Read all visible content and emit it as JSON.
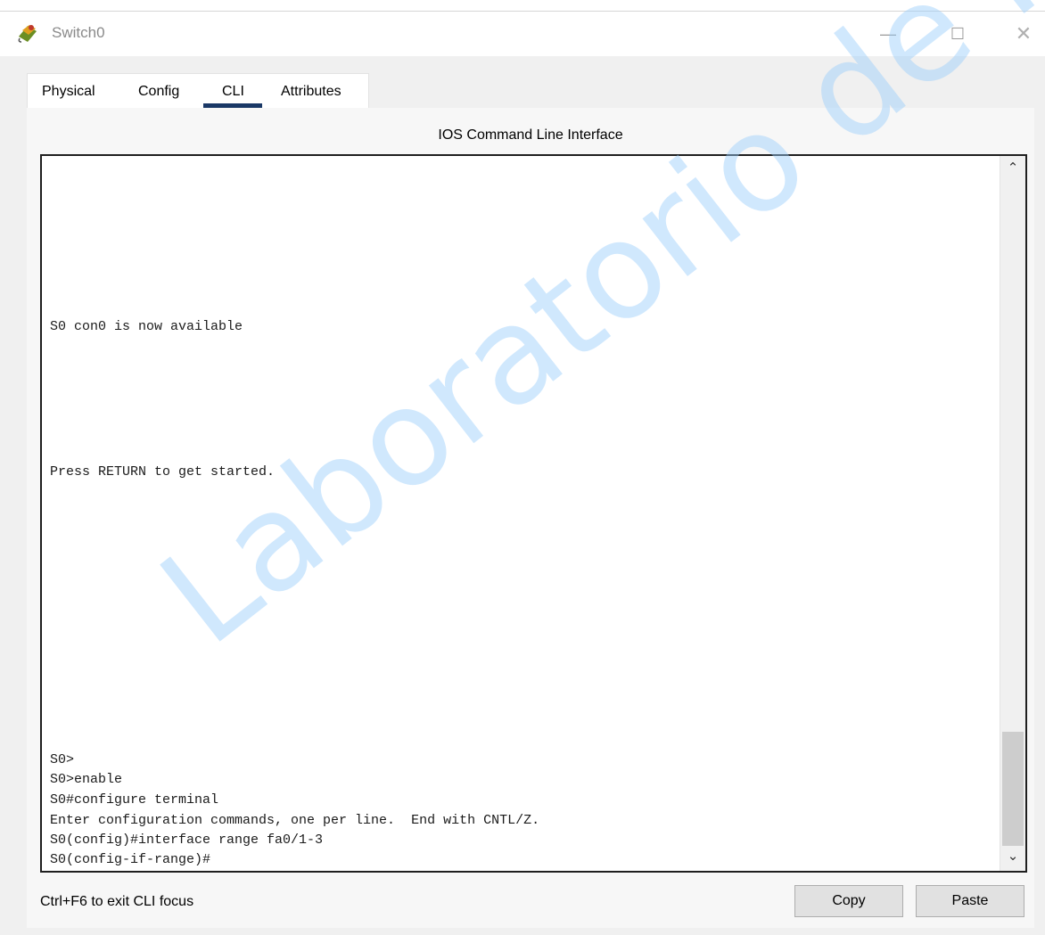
{
  "window": {
    "title": "Switch0",
    "icon": "switch-app-icon",
    "controls": {
      "minimize": "—",
      "maximize": "☐",
      "close": "✕"
    }
  },
  "tabs": [
    {
      "label": "Physical",
      "active": false
    },
    {
      "label": "Config",
      "active": false
    },
    {
      "label": "CLI",
      "active": true
    },
    {
      "label": "Attributes",
      "active": false
    }
  ],
  "panel": {
    "title": "IOS Command Line Interface"
  },
  "terminal": {
    "lines": [
      "S0 con0 is now available",
      "Press RETURN to get started.",
      "S0>",
      "S0>enable",
      "S0#configure terminal",
      "Enter configuration commands, one per line.  End with CNTL/Z.",
      "S0(config)#interface range fa0/1-3",
      "S0(config-if-range)#"
    ]
  },
  "footer": {
    "hint": "Ctrl+F6 to exit CLI focus",
    "copy_label": "Copy",
    "paste_label": "Paste"
  },
  "watermark": {
    "text": "Laboratorio de Redes y Seguridad -"
  },
  "colors": {
    "accent": "#1a3866",
    "watermark": "#96cdfa"
  }
}
